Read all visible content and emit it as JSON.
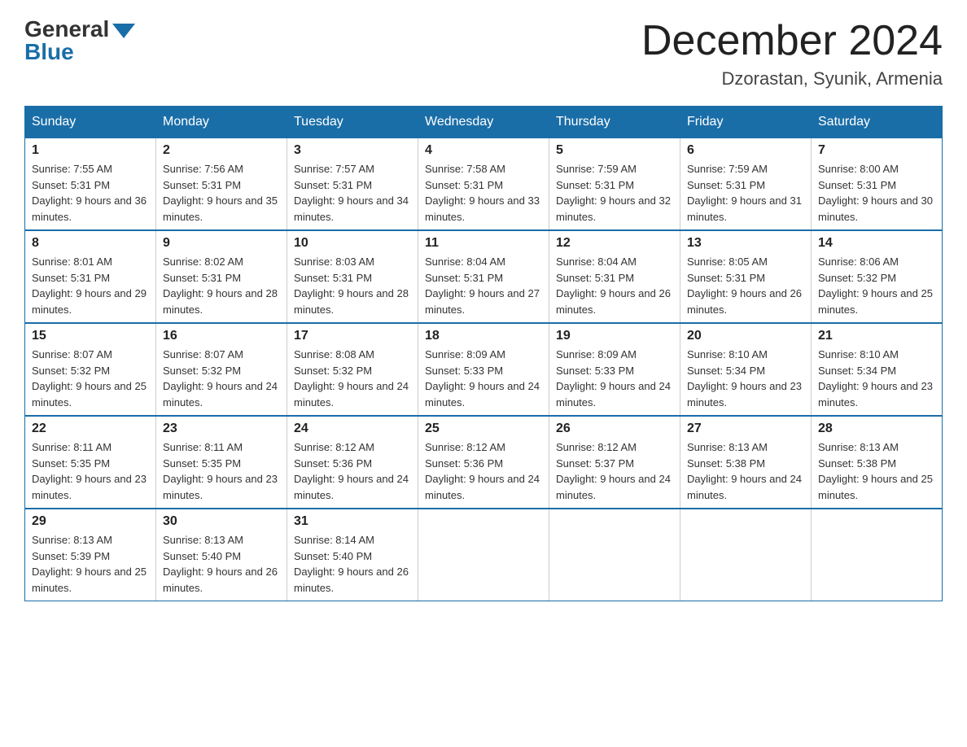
{
  "logo": {
    "general": "General",
    "blue": "Blue"
  },
  "title": "December 2024",
  "subtitle": "Dzorastan, Syunik, Armenia",
  "days": [
    "Sunday",
    "Monday",
    "Tuesday",
    "Wednesday",
    "Thursday",
    "Friday",
    "Saturday"
  ],
  "weeks": [
    [
      {
        "day": "1",
        "sunrise": "7:55 AM",
        "sunset": "5:31 PM",
        "daylight": "9 hours and 36 minutes."
      },
      {
        "day": "2",
        "sunrise": "7:56 AM",
        "sunset": "5:31 PM",
        "daylight": "9 hours and 35 minutes."
      },
      {
        "day": "3",
        "sunrise": "7:57 AM",
        "sunset": "5:31 PM",
        "daylight": "9 hours and 34 minutes."
      },
      {
        "day": "4",
        "sunrise": "7:58 AM",
        "sunset": "5:31 PM",
        "daylight": "9 hours and 33 minutes."
      },
      {
        "day": "5",
        "sunrise": "7:59 AM",
        "sunset": "5:31 PM",
        "daylight": "9 hours and 32 minutes."
      },
      {
        "day": "6",
        "sunrise": "7:59 AM",
        "sunset": "5:31 PM",
        "daylight": "9 hours and 31 minutes."
      },
      {
        "day": "7",
        "sunrise": "8:00 AM",
        "sunset": "5:31 PM",
        "daylight": "9 hours and 30 minutes."
      }
    ],
    [
      {
        "day": "8",
        "sunrise": "8:01 AM",
        "sunset": "5:31 PM",
        "daylight": "9 hours and 29 minutes."
      },
      {
        "day": "9",
        "sunrise": "8:02 AM",
        "sunset": "5:31 PM",
        "daylight": "9 hours and 28 minutes."
      },
      {
        "day": "10",
        "sunrise": "8:03 AM",
        "sunset": "5:31 PM",
        "daylight": "9 hours and 28 minutes."
      },
      {
        "day": "11",
        "sunrise": "8:04 AM",
        "sunset": "5:31 PM",
        "daylight": "9 hours and 27 minutes."
      },
      {
        "day": "12",
        "sunrise": "8:04 AM",
        "sunset": "5:31 PM",
        "daylight": "9 hours and 26 minutes."
      },
      {
        "day": "13",
        "sunrise": "8:05 AM",
        "sunset": "5:31 PM",
        "daylight": "9 hours and 26 minutes."
      },
      {
        "day": "14",
        "sunrise": "8:06 AM",
        "sunset": "5:32 PM",
        "daylight": "9 hours and 25 minutes."
      }
    ],
    [
      {
        "day": "15",
        "sunrise": "8:07 AM",
        "sunset": "5:32 PM",
        "daylight": "9 hours and 25 minutes."
      },
      {
        "day": "16",
        "sunrise": "8:07 AM",
        "sunset": "5:32 PM",
        "daylight": "9 hours and 24 minutes."
      },
      {
        "day": "17",
        "sunrise": "8:08 AM",
        "sunset": "5:32 PM",
        "daylight": "9 hours and 24 minutes."
      },
      {
        "day": "18",
        "sunrise": "8:09 AM",
        "sunset": "5:33 PM",
        "daylight": "9 hours and 24 minutes."
      },
      {
        "day": "19",
        "sunrise": "8:09 AM",
        "sunset": "5:33 PM",
        "daylight": "9 hours and 24 minutes."
      },
      {
        "day": "20",
        "sunrise": "8:10 AM",
        "sunset": "5:34 PM",
        "daylight": "9 hours and 23 minutes."
      },
      {
        "day": "21",
        "sunrise": "8:10 AM",
        "sunset": "5:34 PM",
        "daylight": "9 hours and 23 minutes."
      }
    ],
    [
      {
        "day": "22",
        "sunrise": "8:11 AM",
        "sunset": "5:35 PM",
        "daylight": "9 hours and 23 minutes."
      },
      {
        "day": "23",
        "sunrise": "8:11 AM",
        "sunset": "5:35 PM",
        "daylight": "9 hours and 23 minutes."
      },
      {
        "day": "24",
        "sunrise": "8:12 AM",
        "sunset": "5:36 PM",
        "daylight": "9 hours and 24 minutes."
      },
      {
        "day": "25",
        "sunrise": "8:12 AM",
        "sunset": "5:36 PM",
        "daylight": "9 hours and 24 minutes."
      },
      {
        "day": "26",
        "sunrise": "8:12 AM",
        "sunset": "5:37 PM",
        "daylight": "9 hours and 24 minutes."
      },
      {
        "day": "27",
        "sunrise": "8:13 AM",
        "sunset": "5:38 PM",
        "daylight": "9 hours and 24 minutes."
      },
      {
        "day": "28",
        "sunrise": "8:13 AM",
        "sunset": "5:38 PM",
        "daylight": "9 hours and 25 minutes."
      }
    ],
    [
      {
        "day": "29",
        "sunrise": "8:13 AM",
        "sunset": "5:39 PM",
        "daylight": "9 hours and 25 minutes."
      },
      {
        "day": "30",
        "sunrise": "8:13 AM",
        "sunset": "5:40 PM",
        "daylight": "9 hours and 26 minutes."
      },
      {
        "day": "31",
        "sunrise": "8:14 AM",
        "sunset": "5:40 PM",
        "daylight": "9 hours and 26 minutes."
      },
      null,
      null,
      null,
      null
    ]
  ],
  "labels": {
    "sunrise": "Sunrise:",
    "sunset": "Sunset:",
    "daylight": "Daylight:"
  }
}
